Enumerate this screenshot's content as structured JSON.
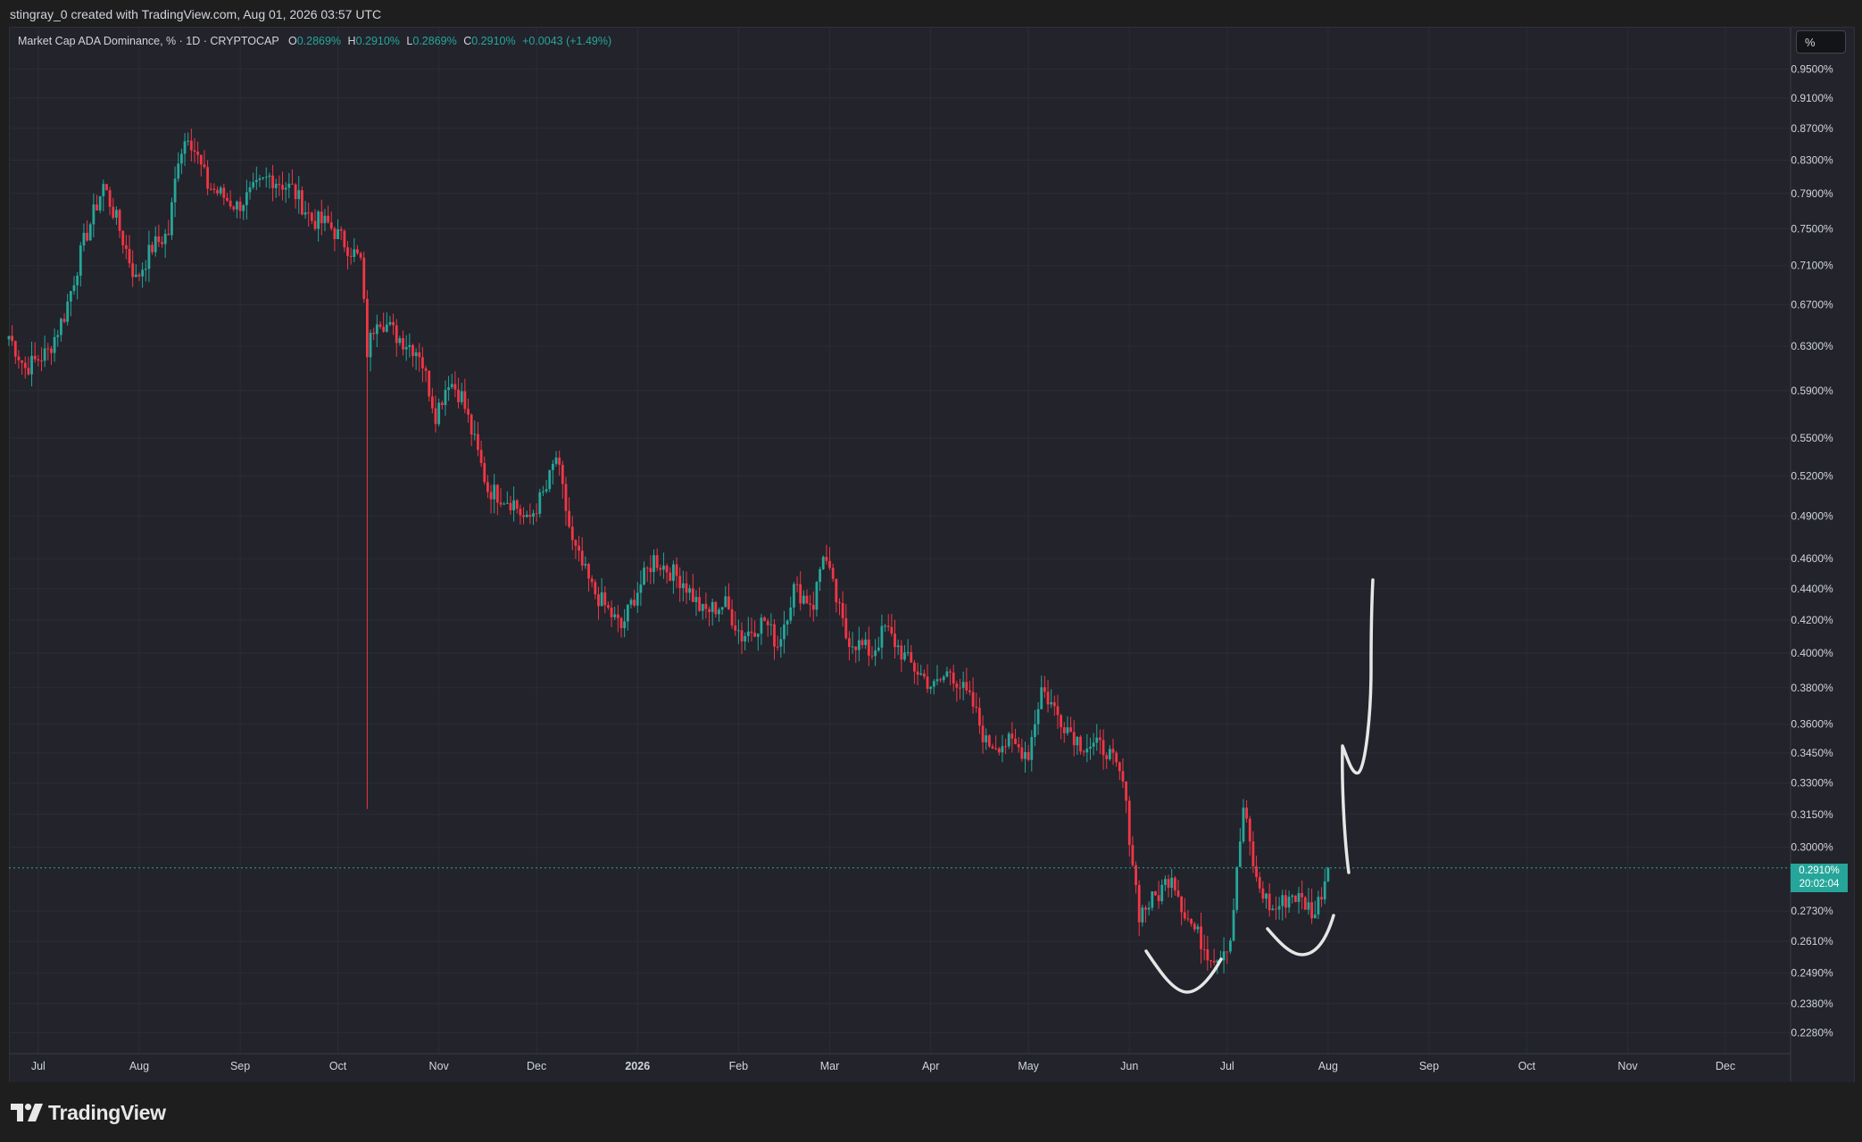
{
  "header": {
    "text": "stingray_0 created with TradingView.com, Aug 01, 2026 03:57 UTC"
  },
  "legend": {
    "symbol": "Market Cap ADA Dominance, % · 1D · CRYPTOCAP",
    "o_label": "O",
    "o_value": "0.2869%",
    "h_label": "H",
    "h_value": "0.2910%",
    "l_label": "L",
    "l_value": "0.2869%",
    "c_label": "C",
    "c_value": "0.2910%",
    "change": "+0.0043 (+1.49%)"
  },
  "scale_button": "%",
  "price_tag": {
    "price": "0.2910%",
    "countdown": "20:02:04"
  },
  "brand": "TradingView",
  "colors": {
    "up": "#26a69a",
    "down": "#f23645",
    "background": "#22232b",
    "grid": "#2c2d36",
    "axis_text": "#d1d4dc",
    "annotation": "#e6e6e6"
  },
  "chart_data": {
    "type": "candlestick",
    "y_scale": "log",
    "ylim": [
      0.221,
      1.01
    ],
    "y_ticks": [
      "0.9500%",
      "0.9100%",
      "0.8700%",
      "0.8300%",
      "0.7900%",
      "0.7500%",
      "0.7100%",
      "0.6700%",
      "0.6300%",
      "0.5900%",
      "0.5500%",
      "0.5200%",
      "0.4900%",
      "0.4600%",
      "0.4400%",
      "0.4200%",
      "0.4000%",
      "0.3800%",
      "0.3600%",
      "0.3450%",
      "0.3300%",
      "0.3150%",
      "0.3000%",
      "0.2730%",
      "0.2610%",
      "0.2490%",
      "0.2380%",
      "0.2280%"
    ],
    "x_ticks": [
      "Jul",
      "Aug",
      "Sep",
      "Oct",
      "Nov",
      "Dec",
      "2026",
      "Feb",
      "Mar",
      "Apr",
      "May",
      "Jun",
      "Jul",
      "Aug",
      "Sep",
      "Oct",
      "Nov",
      "Dec"
    ],
    "x_range": [
      "2025-06-22",
      "2026-12-21"
    ],
    "last_price": 0.291,
    "anchors": [
      [
        "2025-06-22",
        0.64
      ],
      [
        "2025-06-27",
        0.61
      ],
      [
        "2025-07-04",
        0.625
      ],
      [
        "2025-07-09",
        0.66
      ],
      [
        "2025-07-15",
        0.735
      ],
      [
        "2025-07-21",
        0.8
      ],
      [
        "2025-07-25",
        0.76
      ],
      [
        "2025-07-31",
        0.695
      ],
      [
        "2025-08-05",
        0.73
      ],
      [
        "2025-08-10",
        0.745
      ],
      [
        "2025-08-13",
        0.835
      ],
      [
        "2025-08-16",
        0.865
      ],
      [
        "2025-08-22",
        0.8
      ],
      [
        "2025-08-31",
        0.775
      ],
      [
        "2025-09-10",
        0.81
      ],
      [
        "2025-09-17",
        0.795
      ],
      [
        "2025-09-23",
        0.76
      ],
      [
        "2025-09-28",
        0.755
      ],
      [
        "2025-10-08",
        0.715
      ],
      [
        "2025-10-10",
        0.625
      ],
      [
        "2025-10-13",
        0.66
      ],
      [
        "2025-10-19",
        0.64
      ],
      [
        "2025-10-26",
        0.625
      ],
      [
        "2025-10-31",
        0.57
      ],
      [
        "2025-11-04",
        0.6
      ],
      [
        "2025-11-08",
        0.585
      ],
      [
        "2025-11-16",
        0.51
      ],
      [
        "2025-11-24",
        0.5
      ],
      [
        "2025-11-28",
        0.485
      ],
      [
        "2025-12-04",
        0.51
      ],
      [
        "2025-12-07",
        0.535
      ],
      [
        "2025-12-12",
        0.47
      ],
      [
        "2025-12-18",
        0.44
      ],
      [
        "2025-12-27",
        0.415
      ],
      [
        "2025-12-31",
        0.435
      ],
      [
        "2026-01-06",
        0.46
      ],
      [
        "2026-01-15",
        0.445
      ],
      [
        "2026-01-21",
        0.425
      ],
      [
        "2026-01-28",
        0.43
      ],
      [
        "2026-02-02",
        0.41
      ],
      [
        "2026-02-09",
        0.42
      ],
      [
        "2026-02-13",
        0.405
      ],
      [
        "2026-02-18",
        0.44
      ],
      [
        "2026-02-24",
        0.43
      ],
      [
        "2026-02-27",
        0.465
      ],
      [
        "2026-03-06",
        0.41
      ],
      [
        "2026-03-14",
        0.4
      ],
      [
        "2026-03-18",
        0.415
      ],
      [
        "2026-03-25",
        0.395
      ],
      [
        "2026-04-02",
        0.38
      ],
      [
        "2026-04-07",
        0.39
      ],
      [
        "2026-04-14",
        0.37
      ],
      [
        "2026-04-18",
        0.35
      ],
      [
        "2026-04-25",
        0.35
      ],
      [
        "2026-05-01",
        0.345
      ],
      [
        "2026-05-05",
        0.38
      ],
      [
        "2026-05-10",
        0.365
      ],
      [
        "2026-05-17",
        0.35
      ],
      [
        "2026-05-25",
        0.347
      ],
      [
        "2026-05-30",
        0.33
      ],
      [
        "2026-06-04",
        0.272
      ],
      [
        "2026-06-10",
        0.28
      ],
      [
        "2026-06-14",
        0.289
      ],
      [
        "2026-06-18",
        0.272
      ],
      [
        "2026-06-25",
        0.257
      ],
      [
        "2026-06-28",
        0.255
      ],
      [
        "2026-07-02",
        0.262
      ],
      [
        "2026-07-06",
        0.318
      ],
      [
        "2026-07-10",
        0.285
      ],
      [
        "2026-07-15",
        0.273
      ],
      [
        "2026-07-21",
        0.28
      ],
      [
        "2026-07-25",
        0.276
      ],
      [
        "2026-07-28",
        0.272
      ],
      [
        "2026-08-01",
        0.291
      ]
    ],
    "spike_low": {
      "date": "2025-10-10",
      "value": 0.3175
    }
  }
}
